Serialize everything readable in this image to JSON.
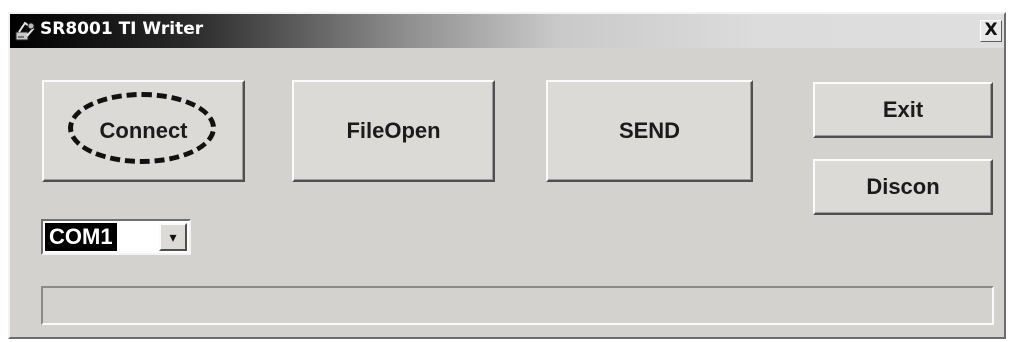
{
  "window": {
    "title": "SR8001 TI Writer",
    "close_label": "X",
    "title_icon": "app-icon"
  },
  "buttons": {
    "connect": "Connect",
    "fileopen": "FileOpen",
    "send": "SEND",
    "exit": "Exit",
    "discon": "Discon"
  },
  "port_select": {
    "value": "COM1",
    "arrow": "▾"
  },
  "progress": {
    "value": 0
  },
  "colors": {
    "window_bg": "#d4d2cf",
    "titlebar_start": "#000000",
    "titlebar_end": "#dedede",
    "highlight": "#111111"
  }
}
